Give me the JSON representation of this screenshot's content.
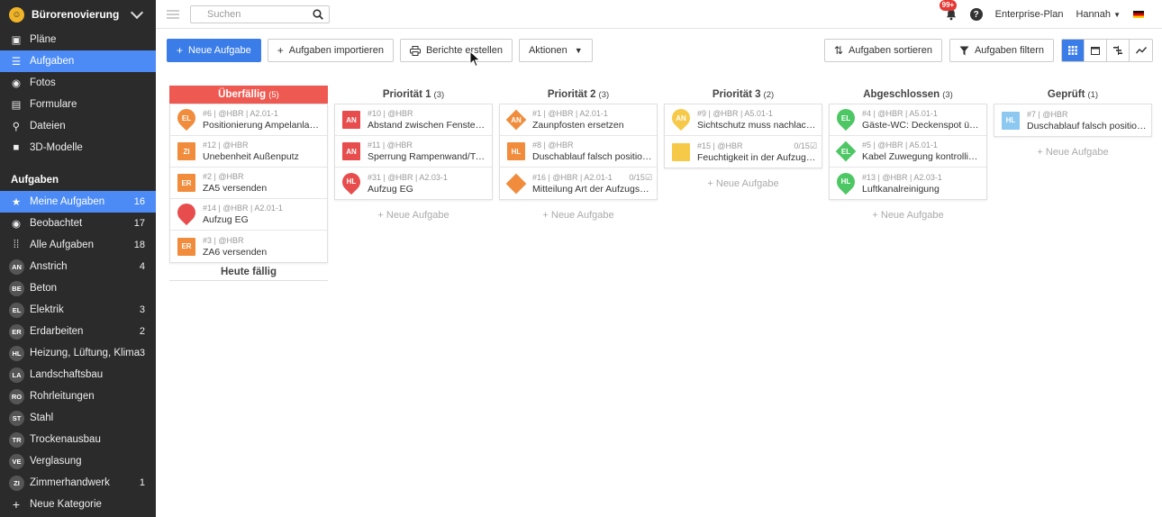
{
  "project": {
    "name": "Bürorenovierung"
  },
  "nav": [
    {
      "label": "Pläne",
      "icon": "plans-icon"
    },
    {
      "label": "Aufgaben",
      "icon": "list-icon",
      "active": true
    },
    {
      "label": "Fotos",
      "icon": "camera-icon"
    },
    {
      "label": "Formulare",
      "icon": "form-icon"
    },
    {
      "label": "Dateien",
      "icon": "paperclip-icon"
    },
    {
      "label": "3D-Modelle",
      "icon": "cube-icon"
    }
  ],
  "tasks_section": {
    "title": "Aufgaben",
    "items": [
      {
        "label": "Meine Aufgaben",
        "count": "16",
        "icon": "star-icon",
        "active": true
      },
      {
        "label": "Beobachtet",
        "count": "17",
        "icon": "eye-icon"
      },
      {
        "label": "Alle Aufgaben",
        "count": "18",
        "icon": "grid-icon"
      }
    ],
    "categories": [
      {
        "abbr": "AN",
        "label": "Anstrich",
        "count": "4"
      },
      {
        "abbr": "BE",
        "label": "Beton",
        "count": ""
      },
      {
        "abbr": "EL",
        "label": "Elektrik",
        "count": "3"
      },
      {
        "abbr": "ER",
        "label": "Erdarbeiten",
        "count": "2"
      },
      {
        "abbr": "HL",
        "label": "Heizung, Lüftung, Klima",
        "count": "3"
      },
      {
        "abbr": "LA",
        "label": "Landschaftsbau",
        "count": ""
      },
      {
        "abbr": "RO",
        "label": "Rohrleitungen",
        "count": ""
      },
      {
        "abbr": "ST",
        "label": "Stahl",
        "count": ""
      },
      {
        "abbr": "TR",
        "label": "Trockenausbau",
        "count": ""
      },
      {
        "abbr": "VE",
        "label": "Verglasung",
        "count": ""
      },
      {
        "abbr": "ZI",
        "label": "Zimmerhandwerk",
        "count": "1"
      }
    ],
    "new_category": "Neue Kategorie"
  },
  "topbar": {
    "search_placeholder": "Suchen",
    "notifications": "99+",
    "help": "?",
    "plan": "Enterprise-Plan",
    "user": "Hannah"
  },
  "toolbar": {
    "new_task": "Neue Aufgabe",
    "import": "Aufgaben importieren",
    "reports": "Berichte erstellen",
    "actions": "Aktionen",
    "sort": "Aufgaben sortieren",
    "filter": "Aufgaben filtern"
  },
  "colors": {
    "accent": "#3b7de8",
    "overdue": "#ee5a52",
    "orange": "#f08c3c",
    "red": "#e84d4d",
    "yellow": "#f7c948",
    "green": "#4cc764",
    "lightblue": "#8cc8f0"
  },
  "add_task_label": "+ Neue Aufgabe",
  "due_today": "Heute fällig",
  "columns": [
    {
      "title": "Überfällig",
      "count": "(5)",
      "overdue": true,
      "show_add": false,
      "cards": [
        {
          "shape": "pin",
          "color": "#f08c3c",
          "abbr": "EL",
          "meta": "#6 | @HBR | A2.01-1",
          "progress": "",
          "title": "Positionierung Ampelanlage k..."
        },
        {
          "shape": "square",
          "color": "#f08c3c",
          "abbr": "ZI",
          "meta": "#12 | @HBR",
          "progress": "",
          "title": "Unebenheit Außenputz"
        },
        {
          "shape": "square",
          "color": "#f08c3c",
          "abbr": "ER",
          "meta": "#2 | @HBR",
          "progress": "",
          "title": "ZA5 versenden"
        },
        {
          "shape": "pin",
          "color": "#e84d4d",
          "abbr": "",
          "meta": "#14 | @HBR | A2.01-1",
          "progress": "",
          "title": "Aufzug EG"
        },
        {
          "shape": "square",
          "color": "#f08c3c",
          "abbr": "ER",
          "meta": "#3 | @HBR",
          "progress": "",
          "title": "ZA6 versenden"
        }
      ]
    },
    {
      "title": "Priorität 1",
      "count": "(3)",
      "show_add": true,
      "cards": [
        {
          "shape": "square",
          "color": "#e84d4d",
          "abbr": "AN",
          "meta": "#10 | @HBR",
          "progress": "",
          "title": "Abstand zwischen Fenster un..."
        },
        {
          "shape": "square",
          "color": "#e84d4d",
          "abbr": "AN",
          "meta": "#11 | @HBR",
          "progress": "",
          "title": "Sperrung Rampenwand/T-Stü..."
        },
        {
          "shape": "pin",
          "color": "#e84d4d",
          "abbr": "HL",
          "meta": "#31 | @HBR | A2.03-1",
          "progress": "",
          "title": "Aufzug EG"
        }
      ]
    },
    {
      "title": "Priorität 2",
      "count": "(3)",
      "show_add": true,
      "cards": [
        {
          "shape": "diamond",
          "color": "#f08c3c",
          "abbr": "AN",
          "meta": "#1 | @HBR | A2.01-1",
          "progress": "",
          "title": "Zaunpfosten ersetzen"
        },
        {
          "shape": "square",
          "color": "#f08c3c",
          "abbr": "HL",
          "meta": "#8 | @HBR",
          "progress": "",
          "title": "Duschablauf falsch positioniert"
        },
        {
          "shape": "diamond",
          "color": "#f08c3c",
          "abbr": "",
          "meta": "#16 | @HBR | A2.01-1",
          "progress": "0/15☑",
          "title": "Mitteilung Art der Aufzugs-N..."
        }
      ]
    },
    {
      "title": "Priorität 3",
      "count": "(2)",
      "show_add": true,
      "cards": [
        {
          "shape": "pin",
          "color": "#f7c948",
          "abbr": "AN",
          "meta": "#9 | @HBR | A5.01-1",
          "progress": "",
          "title": "Sichtschutz muss nachlackiert..."
        },
        {
          "shape": "square",
          "color": "#f7c948",
          "abbr": "",
          "meta": "#15 | @HBR",
          "progress": "0/15☑",
          "title": "Feuchtigkeit in der Aufzugsun..."
        }
      ]
    },
    {
      "title": "Abgeschlossen",
      "count": "(3)",
      "show_add": true,
      "cards": [
        {
          "shape": "pin",
          "color": "#4cc764",
          "abbr": "EL",
          "meta": "#4 | @HBR | A5.01-1",
          "progress": "",
          "title": "Gäste-WC: Deckenspot über ..."
        },
        {
          "shape": "diamond",
          "color": "#4cc764",
          "abbr": "EL",
          "meta": "#5 | @HBR | A5.01-1",
          "progress": "",
          "title": "Kabel Zuwegung kontrollieren"
        },
        {
          "shape": "pin",
          "color": "#4cc764",
          "abbr": "HL",
          "meta": "#13 | @HBR | A2.03-1",
          "progress": "",
          "title": "Luftkanalreinigung"
        }
      ]
    },
    {
      "title": "Geprüft",
      "count": "(1)",
      "show_add": true,
      "cards": [
        {
          "shape": "square",
          "color": "#8cc8f0",
          "abbr": "HL",
          "meta": "#7 | @HBR",
          "progress": "",
          "title": "Duschablauf falsch positioniert"
        }
      ]
    }
  ]
}
